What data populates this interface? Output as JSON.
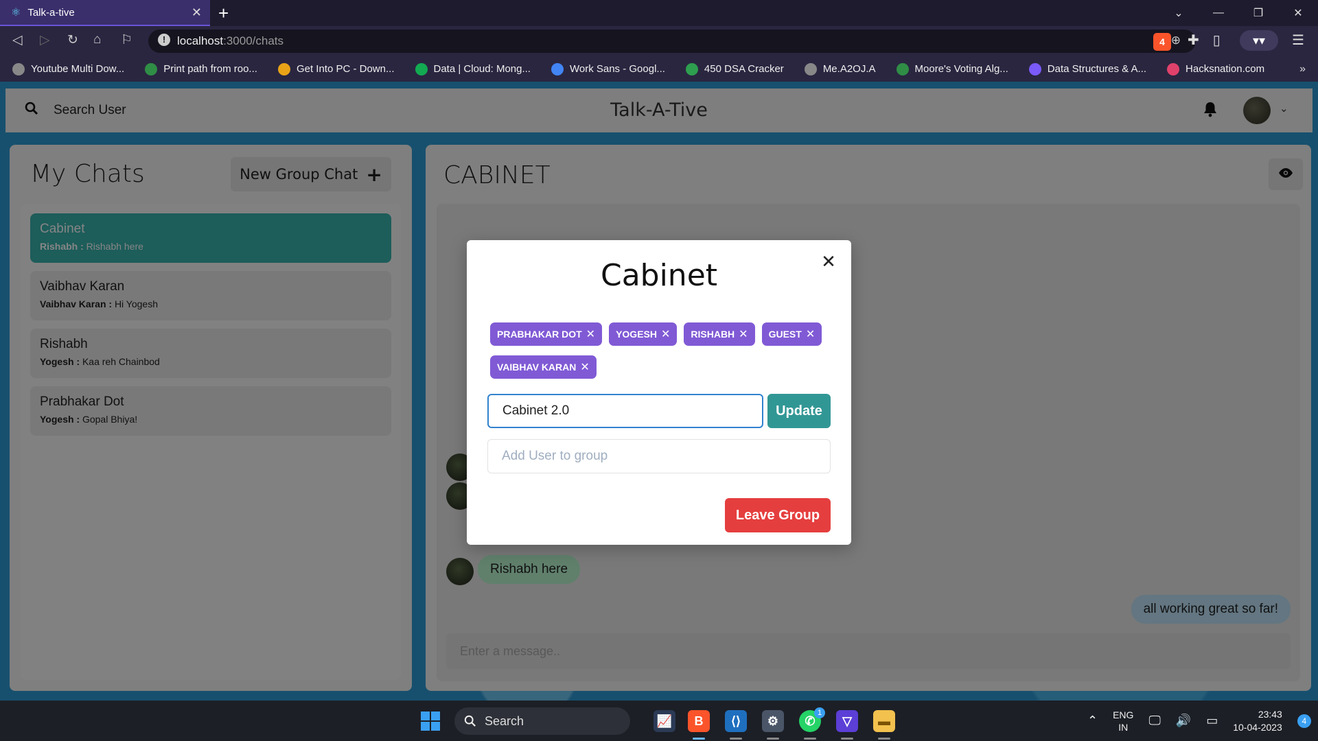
{
  "browser": {
    "tab_title": "Talk-a-tive",
    "url_host": "localhost",
    "url_rest": ":3000/chats",
    "shield_count": "4",
    "bookmarks": [
      {
        "label": "Youtube Multi Dow...",
        "icon": "globe-icon",
        "color": "#888888"
      },
      {
        "label": "Print path from roo...",
        "icon": "gfg-icon",
        "color": "#2f8d46"
      },
      {
        "label": "Get Into PC - Down...",
        "icon": "g-icon",
        "color": "#e8a317"
      },
      {
        "label": "Data | Cloud: Mong...",
        "icon": "mongodb-leaf-icon",
        "color": "#13aa52"
      },
      {
        "label": "Work Sans - Googl...",
        "icon": "google-fonts-icon",
        "color": "#4285f4"
      },
      {
        "label": "450 DSA Cracker",
        "icon": "sheet-icon",
        "color": "#2e9e4f"
      },
      {
        "label": "Me.A2OJ.A",
        "icon": "globe-icon",
        "color": "#888888"
      },
      {
        "label": "Moore's Voting Alg...",
        "icon": "gfg-icon",
        "color": "#2f8d46"
      },
      {
        "label": "Data Structures & A...",
        "icon": "check-badge-icon",
        "color": "#7a5af8"
      },
      {
        "label": "Hacksnation.com",
        "icon": "flag-icon",
        "color": "#e0416b"
      }
    ]
  },
  "header": {
    "search_label": "Search User",
    "app_title": "Talk-A-Tive"
  },
  "my_chats": {
    "title": "My Chats",
    "new_group_label": "New Group Chat",
    "chats": [
      {
        "name": "Cabinet",
        "sender": "Rishabh :",
        "message": "Rishabh here",
        "active": true
      },
      {
        "name": "Vaibhav Karan",
        "sender": "Vaibhav Karan :",
        "message": "Hi Yogesh",
        "active": false
      },
      {
        "name": "Rishabh",
        "sender": "Yogesh :",
        "message": "Kaa reh Chainbod",
        "active": false
      },
      {
        "name": "Prabhakar Dot",
        "sender": "Yogesh :",
        "message": "Gopal Bhiya!",
        "active": false
      }
    ]
  },
  "chat": {
    "title": "CABINET",
    "messages": [
      {
        "text": "Rishabh here",
        "mine": false
      },
      {
        "text": "all working great so far!",
        "mine": true
      }
    ],
    "input_placeholder": "Enter a message.."
  },
  "modal": {
    "title": "Cabinet",
    "members": [
      "PRABHAKAR DOT",
      "YOGESH",
      "RISHABH",
      "GUEST",
      "VAIBHAV KARAN"
    ],
    "rename_value": "Cabinet 2.0",
    "update_label": "Update",
    "add_user_placeholder": "Add User to group",
    "leave_label": "Leave Group"
  },
  "taskbar": {
    "search_label": "Search",
    "lang_top": "ENG",
    "lang_bottom": "IN",
    "time": "23:43",
    "date": "10-04-2023",
    "notification_count": "4",
    "whatsapp_badge": "1"
  },
  "colors": {
    "accent_teal": "#38b2ac",
    "chip_purple": "#805ad5",
    "danger_red": "#e53e3e",
    "update_teal": "#319795"
  }
}
